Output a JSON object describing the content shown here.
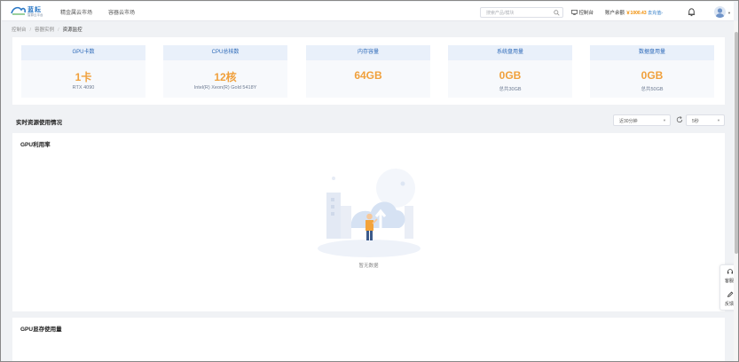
{
  "header": {
    "logo_text": "蓝耘",
    "logo_sub": "智算云平台",
    "nav": [
      "精金属云市场",
      "容器云市场"
    ],
    "search_placeholder": "搜索产品/模块",
    "console_label": "控制台",
    "balance_label": "账户余额",
    "balance_value": "￥1000.43",
    "recharge_label": "去充值",
    "recharge_chevron": "›"
  },
  "breadcrumb": [
    "控制台",
    "容器实例",
    "资源监控"
  ],
  "stats": [
    {
      "title": "GPU卡数",
      "value": "1卡",
      "sub": "RTX 4090"
    },
    {
      "title": "CPU总核数",
      "value": "12核",
      "sub": "Intel(R) Xeon(R) Gold 5418Y"
    },
    {
      "title": "内存容量",
      "value": "64GB",
      "sub": ""
    },
    {
      "title": "系统盘用量",
      "value": "0GB",
      "sub": "总共30GB"
    },
    {
      "title": "数据盘用量",
      "value": "0GB",
      "sub": "总共50GB"
    }
  ],
  "section": {
    "title": "实时资源使用情况",
    "range_select": "近30分钟",
    "interval_select": "5秒"
  },
  "charts": [
    {
      "title": "GPU利用率",
      "empty_text": "暂无数据"
    },
    {
      "title": "GPU显存使用量",
      "empty_text": "暂无数据"
    }
  ],
  "float": {
    "service": "客服",
    "feedback": "反馈"
  },
  "colors": {
    "accent_blue": "#2c69b8",
    "value_orange": "#f0a03c",
    "balance_orange": "#f08c00"
  }
}
